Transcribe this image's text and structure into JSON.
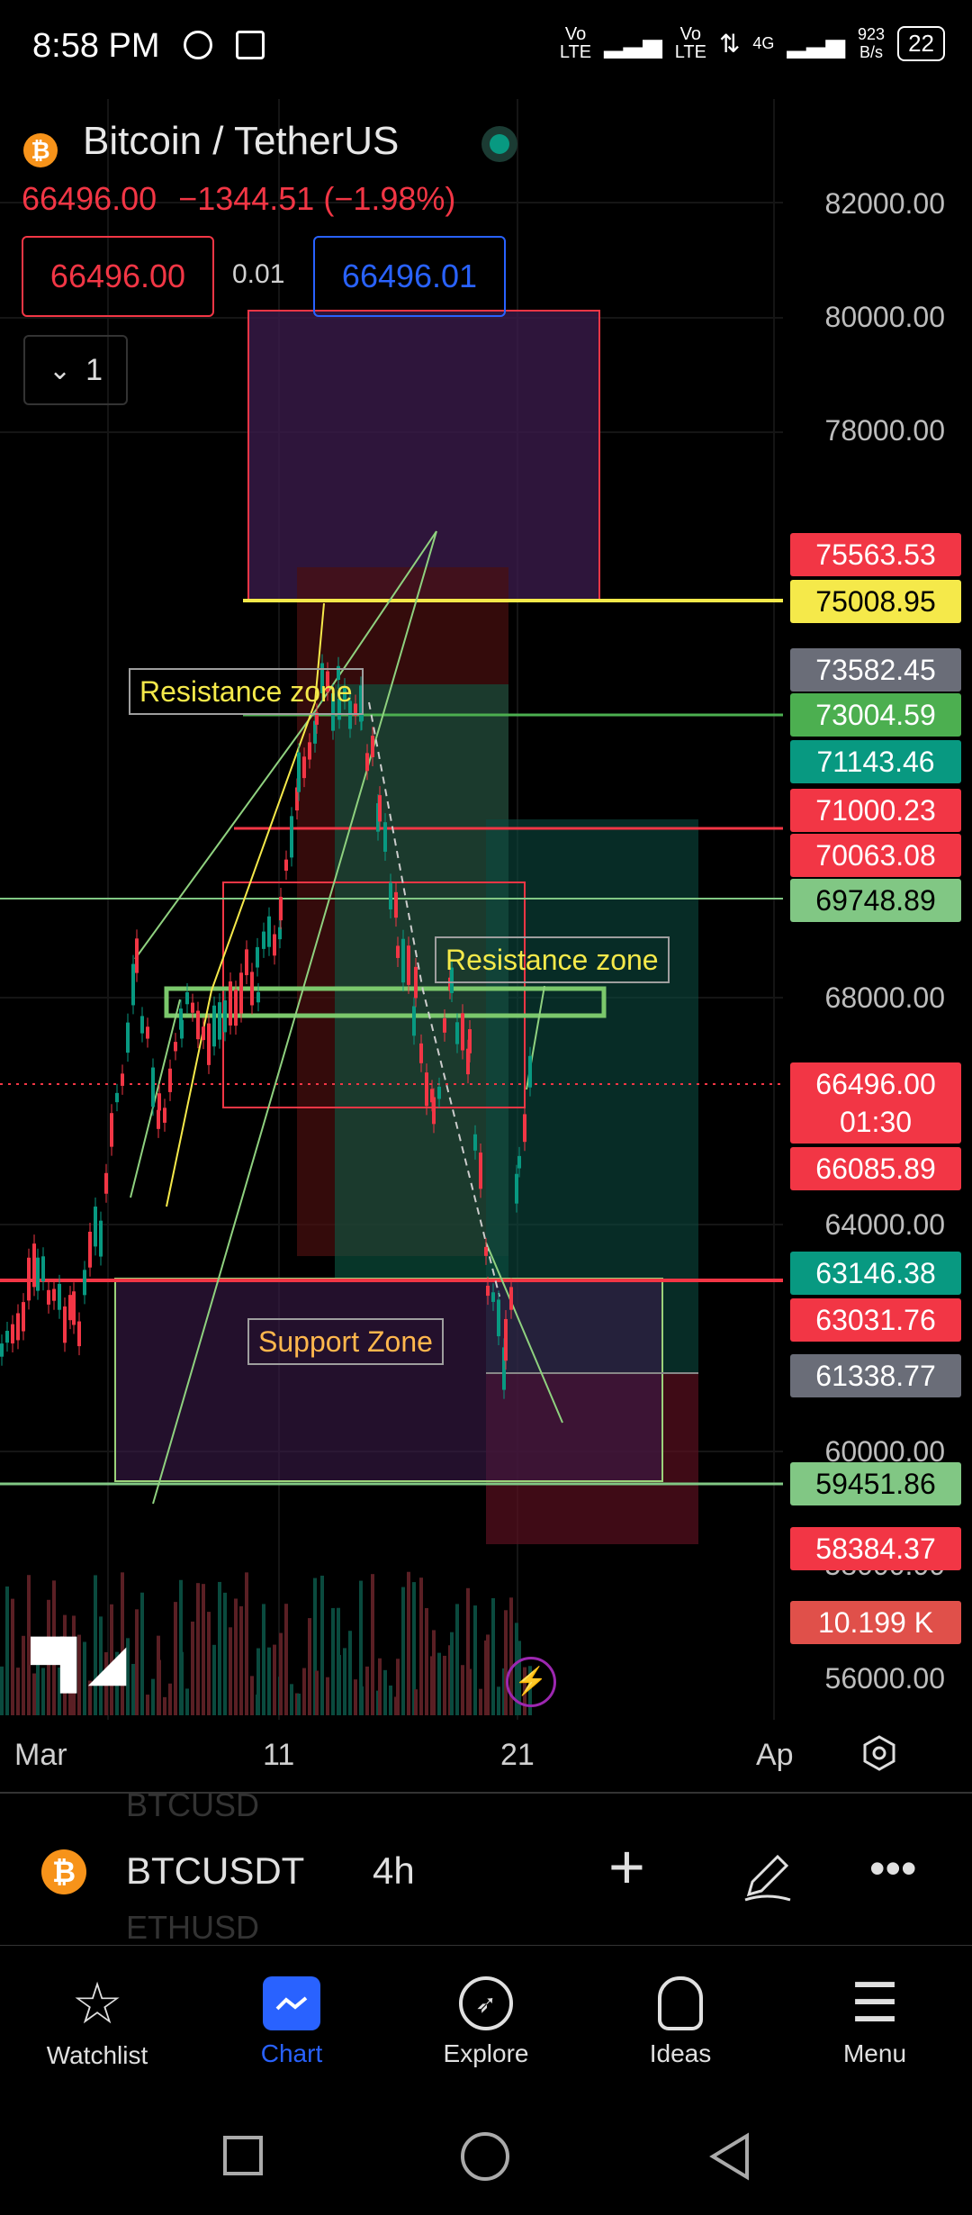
{
  "status": {
    "time": "8:58 PM",
    "net_speed": "923\nB/s",
    "battery": "22",
    "signal1": "Vo\nLTE",
    "signal2": "Vo\nLTE",
    "net": "4G"
  },
  "header": {
    "symbol_title": "Bitcoin / TetherUS",
    "last_price": "66496.00",
    "change": "−1344.51 (−1.98%)",
    "sell_price": "66496.00",
    "spread": "0.01",
    "buy_price": "66496.01",
    "layout_count": "1"
  },
  "price_axis": [
    "82000.00",
    "80000.00",
    "78000.00",
    "68000.00",
    "64000.00",
    "60000.00",
    "58000.00",
    "56000.00"
  ],
  "price_tags": [
    {
      "text": "75563.53",
      "bg": "#f23645",
      "fg": "#ffffff"
    },
    {
      "text": "75008.95",
      "bg": "#f5e94a",
      "fg": "#000000"
    },
    {
      "text": "73582.45",
      "bg": "#6a6d78",
      "fg": "#ffffff"
    },
    {
      "text": "73004.59",
      "bg": "#4caf50",
      "fg": "#ffffff"
    },
    {
      "text": "71143.46",
      "bg": "#089981",
      "fg": "#ffffff"
    },
    {
      "text": "71000.23",
      "bg": "#f23645",
      "fg": "#ffffff"
    },
    {
      "text": "70063.08",
      "bg": "#f23645",
      "fg": "#ffffff"
    },
    {
      "text": "69748.89",
      "bg": "#81c784",
      "fg": "#000000"
    },
    {
      "text": "66496.00",
      "bg": "#f23645",
      "fg": "#ffffff"
    },
    {
      "text": "01:30",
      "bg": "#f23645",
      "fg": "#ffffff"
    },
    {
      "text": "66085.89",
      "bg": "#f23645",
      "fg": "#ffffff"
    },
    {
      "text": "63146.38",
      "bg": "#089981",
      "fg": "#ffffff"
    },
    {
      "text": "63031.76",
      "bg": "#f23645",
      "fg": "#ffffff"
    },
    {
      "text": "61338.77",
      "bg": "#6a6d78",
      "fg": "#ffffff"
    },
    {
      "text": "59451.86",
      "bg": "#81c784",
      "fg": "#000000"
    },
    {
      "text": "58384.37",
      "bg": "#f23645",
      "fg": "#ffffff"
    },
    {
      "text": "10.199 K",
      "bg": "#e0504a",
      "fg": "#ffffff"
    }
  ],
  "annotations": {
    "resistance1": "Resistance zone",
    "resistance2": "Resistance zone",
    "support": "Support Zone"
  },
  "time_axis": {
    "mar": "Mar",
    "d11": "11",
    "d21": "21",
    "apr": "Ap"
  },
  "symbol_ghost_top": "BTCUSD",
  "symbol_ghost_bottom": "ETHUSD",
  "toolbar": {
    "symbol": "BTCUSDT",
    "interval": "4h"
  },
  "nav": {
    "watchlist": "Watchlist",
    "chart": "Chart",
    "explore": "Explore",
    "ideas": "Ideas",
    "menu": "Menu"
  },
  "colors": {
    "accent": "#2962ff",
    "red": "#f23645",
    "green": "#089981",
    "yellow": "#f5e94a"
  }
}
